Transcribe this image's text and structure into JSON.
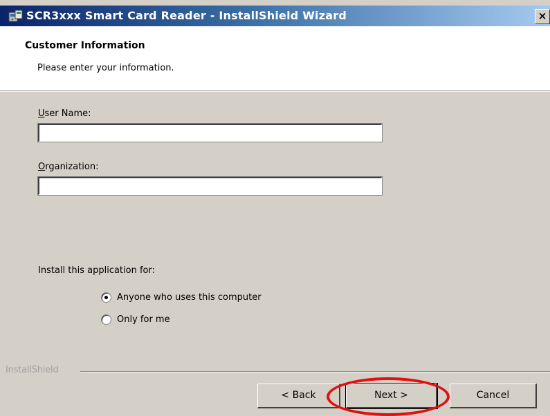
{
  "window": {
    "title": "SCR3xxx Smart Card Reader - InstallShield Wizard",
    "close_glyph": "×",
    "icon": "installer-icon"
  },
  "header": {
    "title": "Customer Information",
    "subtitle": "Please enter your information."
  },
  "form": {
    "user_name": {
      "access_key": "U",
      "label_rest": "ser Name:",
      "value": ""
    },
    "organization": {
      "access_key": "O",
      "label_rest": "rganization:",
      "value": ""
    },
    "install_for_label": "Install this application for:",
    "options": [
      {
        "label": "Anyone who uses this computer",
        "selected": true
      },
      {
        "label": "Only for me",
        "selected": false
      }
    ]
  },
  "footer": {
    "brand": "InstallShield",
    "back_label": "< Back",
    "next_label": "Next >",
    "cancel_label": "Cancel"
  },
  "annotation": {
    "color": "#e01010",
    "target": "next-button"
  },
  "colors": {
    "dialog_bg": "#d4d0c8",
    "title_gradient_start": "#0a246a",
    "title_gradient_end": "#a6caf0"
  }
}
